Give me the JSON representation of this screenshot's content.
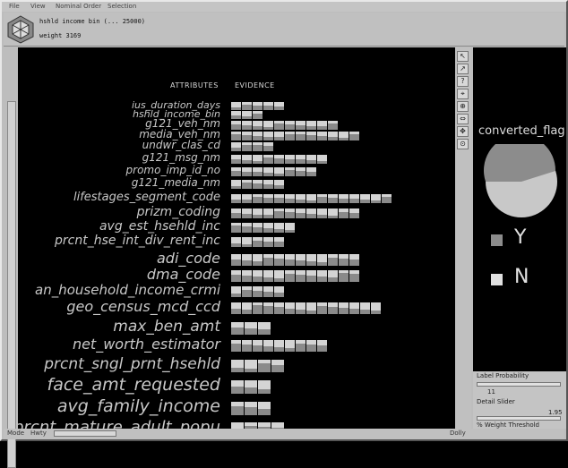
{
  "menu": {
    "file": "File",
    "view": "View",
    "nominal_order": "Nominal Order",
    "selection": "Selection"
  },
  "header": {
    "line1": "hshld income bin   (... 25000)",
    "line2": "weight   3169"
  },
  "columns": {
    "attributes": "ATTRIBUTES",
    "evidence": "EVIDENCE"
  },
  "attributes": [
    {
      "label": "ius_duration_days",
      "size": 11,
      "n": 5
    },
    {
      "label": "hshld_income_bin",
      "size": 11,
      "n": 3
    },
    {
      "label": "g121_veh_nm",
      "size": 12,
      "n": 10
    },
    {
      "label": "media_veh_nm",
      "size": 12,
      "n": 12
    },
    {
      "label": "undwr_clas_cd",
      "size": 12,
      "n": 4
    },
    {
      "label": "g121_msg_nm",
      "size": 12,
      "n": 9
    },
    {
      "label": "promo_imp_id_no",
      "size": 12,
      "n": 8
    },
    {
      "label": "g121_media_nm",
      "size": 12,
      "n": 5
    },
    {
      "label": "lifestages_segment_code",
      "size": 13,
      "n": 15
    },
    {
      "label": "prizm_coding",
      "size": 14,
      "n": 12
    },
    {
      "label": "avg_est_hsehld_inc",
      "size": 14,
      "n": 6
    },
    {
      "label": "prcnt_hse_int_div_rent_inc",
      "size": 14,
      "n": 5
    },
    {
      "label": "adi_code",
      "size": 16,
      "n": 12
    },
    {
      "label": "dma_code",
      "size": 16,
      "n": 12
    },
    {
      "label": "an_household_income_crmi",
      "size": 15,
      "n": 5
    },
    {
      "label": "geo_census_mcd_ccd",
      "size": 16,
      "n": 14
    },
    {
      "label": "max_ben_amt",
      "size": 17,
      "n": 3
    },
    {
      "label": "net_worth_estimator",
      "size": 16,
      "n": 9
    },
    {
      "label": "prcnt_sngl_prnt_hsehld",
      "size": 17,
      "n": 4
    },
    {
      "label": "face_amt_requested",
      "size": 19,
      "n": 3
    },
    {
      "label": "avg_family_income",
      "size": 19,
      "n": 3
    },
    {
      "label": "prcnt_mature_adult_popu",
      "size": 18,
      "n": 4
    }
  ],
  "side_panel": {
    "title": "converted_flag",
    "yes_label": "Y",
    "no_label": "N"
  },
  "controls": {
    "label_probability": "Label Probability",
    "label_prob_value": "11",
    "detail_slider": "Detail Slider",
    "detail_value": "1.95",
    "weight_threshold": "% Weight Threshold"
  },
  "status": {
    "left": "Mode",
    "mid": "Hwty",
    "right": "Dolly"
  },
  "tools": [
    "↖",
    "↗",
    "?",
    "⌖",
    "⊕",
    "⇔",
    "✥",
    "⊙"
  ]
}
